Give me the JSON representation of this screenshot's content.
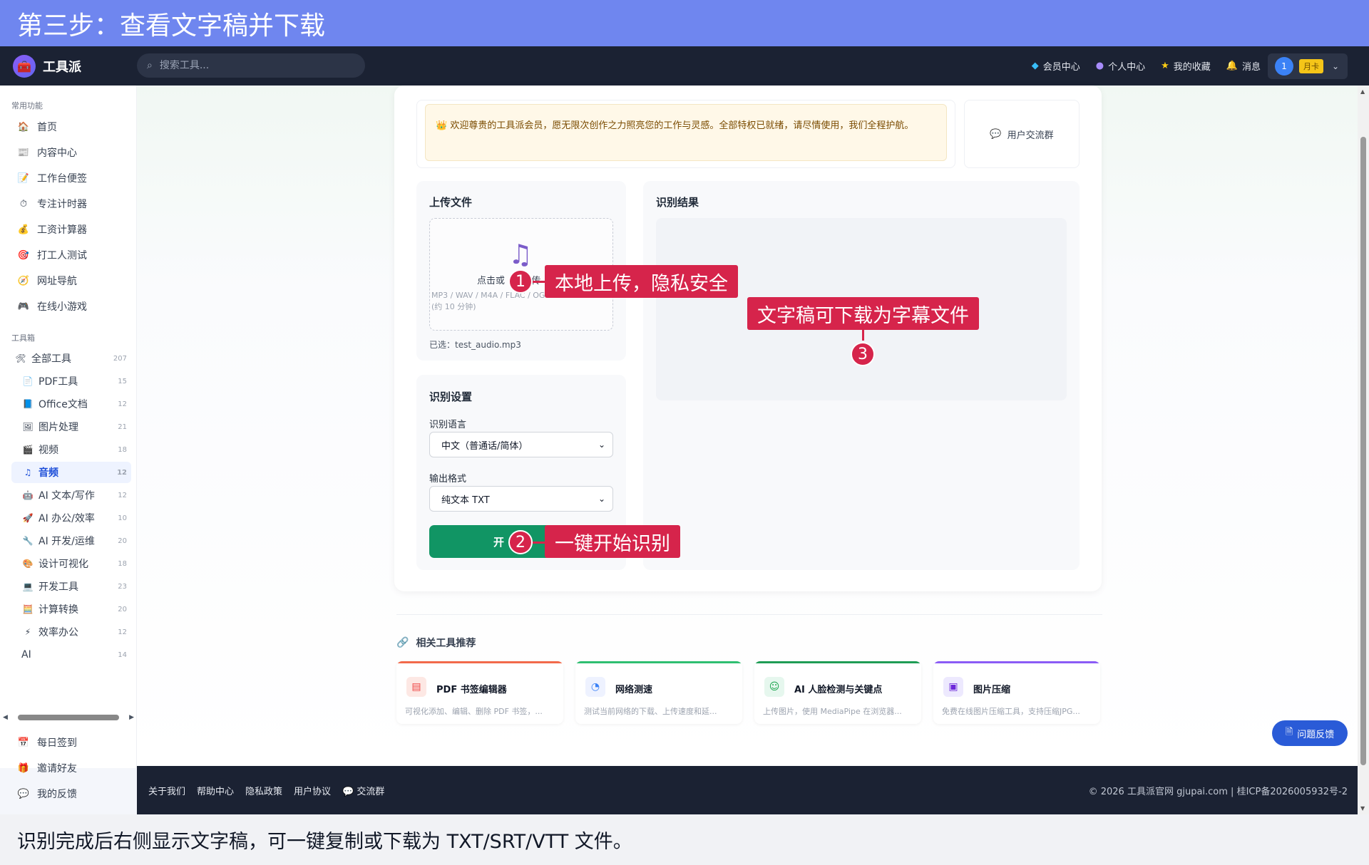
{
  "banner": {
    "title": "第三步：查看文字稿并下载"
  },
  "header": {
    "brand": "工具派",
    "search_placeholder": "搜索工具...",
    "nav": [
      {
        "label": "会员中心",
        "icon": "diamond-icon"
      },
      {
        "label": "个人中心",
        "icon": "user-icon"
      },
      {
        "label": "我的收藏",
        "icon": "star-icon"
      },
      {
        "label": "消息",
        "icon": "bell-icon"
      }
    ],
    "user": {
      "avatar": "1",
      "badge": "月卡"
    }
  },
  "sidebar": {
    "section_common": "常用功能",
    "common_items": [
      "首页",
      "内容中心",
      "工作台便签",
      "专注计时器",
      "工资计算器",
      "打工人测试",
      "网址导航",
      "在线小游戏"
    ],
    "section_tools": "工具箱",
    "tools": [
      {
        "label": "全部工具",
        "count": "207"
      },
      {
        "label": "PDF工具",
        "count": "15"
      },
      {
        "label": "Office文档",
        "count": "12"
      },
      {
        "label": "图片处理",
        "count": "21"
      },
      {
        "label": "视频",
        "count": "18"
      },
      {
        "label": "音频",
        "count": "12"
      },
      {
        "label": "AI 文本/写作",
        "count": "12"
      },
      {
        "label": "AI 办公/效率",
        "count": "10"
      },
      {
        "label": "AI 开发/运维",
        "count": "20"
      },
      {
        "label": "设计可视化",
        "count": "18"
      },
      {
        "label": "开发工具",
        "count": "23"
      },
      {
        "label": "计算转换",
        "count": "20"
      },
      {
        "label": "效率办公",
        "count": "12"
      },
      {
        "label": "AI",
        "count": "14"
      }
    ],
    "bottom_items": [
      "每日签到",
      "邀请好友",
      "我的反馈"
    ]
  },
  "welcome": {
    "text": "👑 欢迎尊贵的工具派会员，愿无限次创作之力照亮您的工作与灵感。全部特权已就绪，请尽情使用，我们全程护航。",
    "group_button": "用户交流群"
  },
  "upload": {
    "title": "上传文件",
    "dz_text": "点击或",
    "dz_text_tail": "传",
    "dz_hint_line1": "MP3 / WAV / M4A / FLAC / OG",
    "dz_hint_line2": "(约 10 分钟)",
    "selected": "已选：test_audio.mp3"
  },
  "settings": {
    "title": "识别设置",
    "lang_label": "识别语言",
    "lang_value": "中文（普通话/简体）",
    "format_label": "输出格式",
    "format_value": "纯文本 TXT",
    "start_button": "开"
  },
  "result": {
    "title": "识别结果"
  },
  "callouts": {
    "c1": {
      "num": "1",
      "text": "本地上传，隐私安全"
    },
    "c2": {
      "num": "2",
      "text": "一键开始识别"
    },
    "c3": {
      "num": "3",
      "text": "文字稿可下载为字幕文件"
    }
  },
  "related": {
    "title": "相关工具推荐",
    "items": [
      {
        "name": "PDF 书签编辑器",
        "desc": "可视化添加、编辑、删除 PDF 书签，...",
        "color": "#f26a4b"
      },
      {
        "name": "网络测速",
        "desc": "测试当前网络的下载、上传速度和延...",
        "color": "#2fbf71"
      },
      {
        "name": "AI 人脸检测与关键点",
        "desc": "上传图片，使用 MediaPipe 在浏览器...",
        "color": "#1f9d55"
      },
      {
        "name": "图片压缩",
        "desc": "免费在线图片压缩工具，支持压缩JPG...",
        "color": "#8b5cf6"
      }
    ]
  },
  "feedback": {
    "label": "问题反馈"
  },
  "footer": {
    "links": [
      "关于我们",
      "帮助中心",
      "隐私政策",
      "用户协议",
      "💬 交流群"
    ],
    "copyright": "© 2026 工具派官网 gjupai.com | 桂ICP备2026005932号-2"
  },
  "caption": {
    "text": "识别完成后右侧显示文字稿，可一键复制或下载为 TXT/SRT/VTT 文件。"
  }
}
